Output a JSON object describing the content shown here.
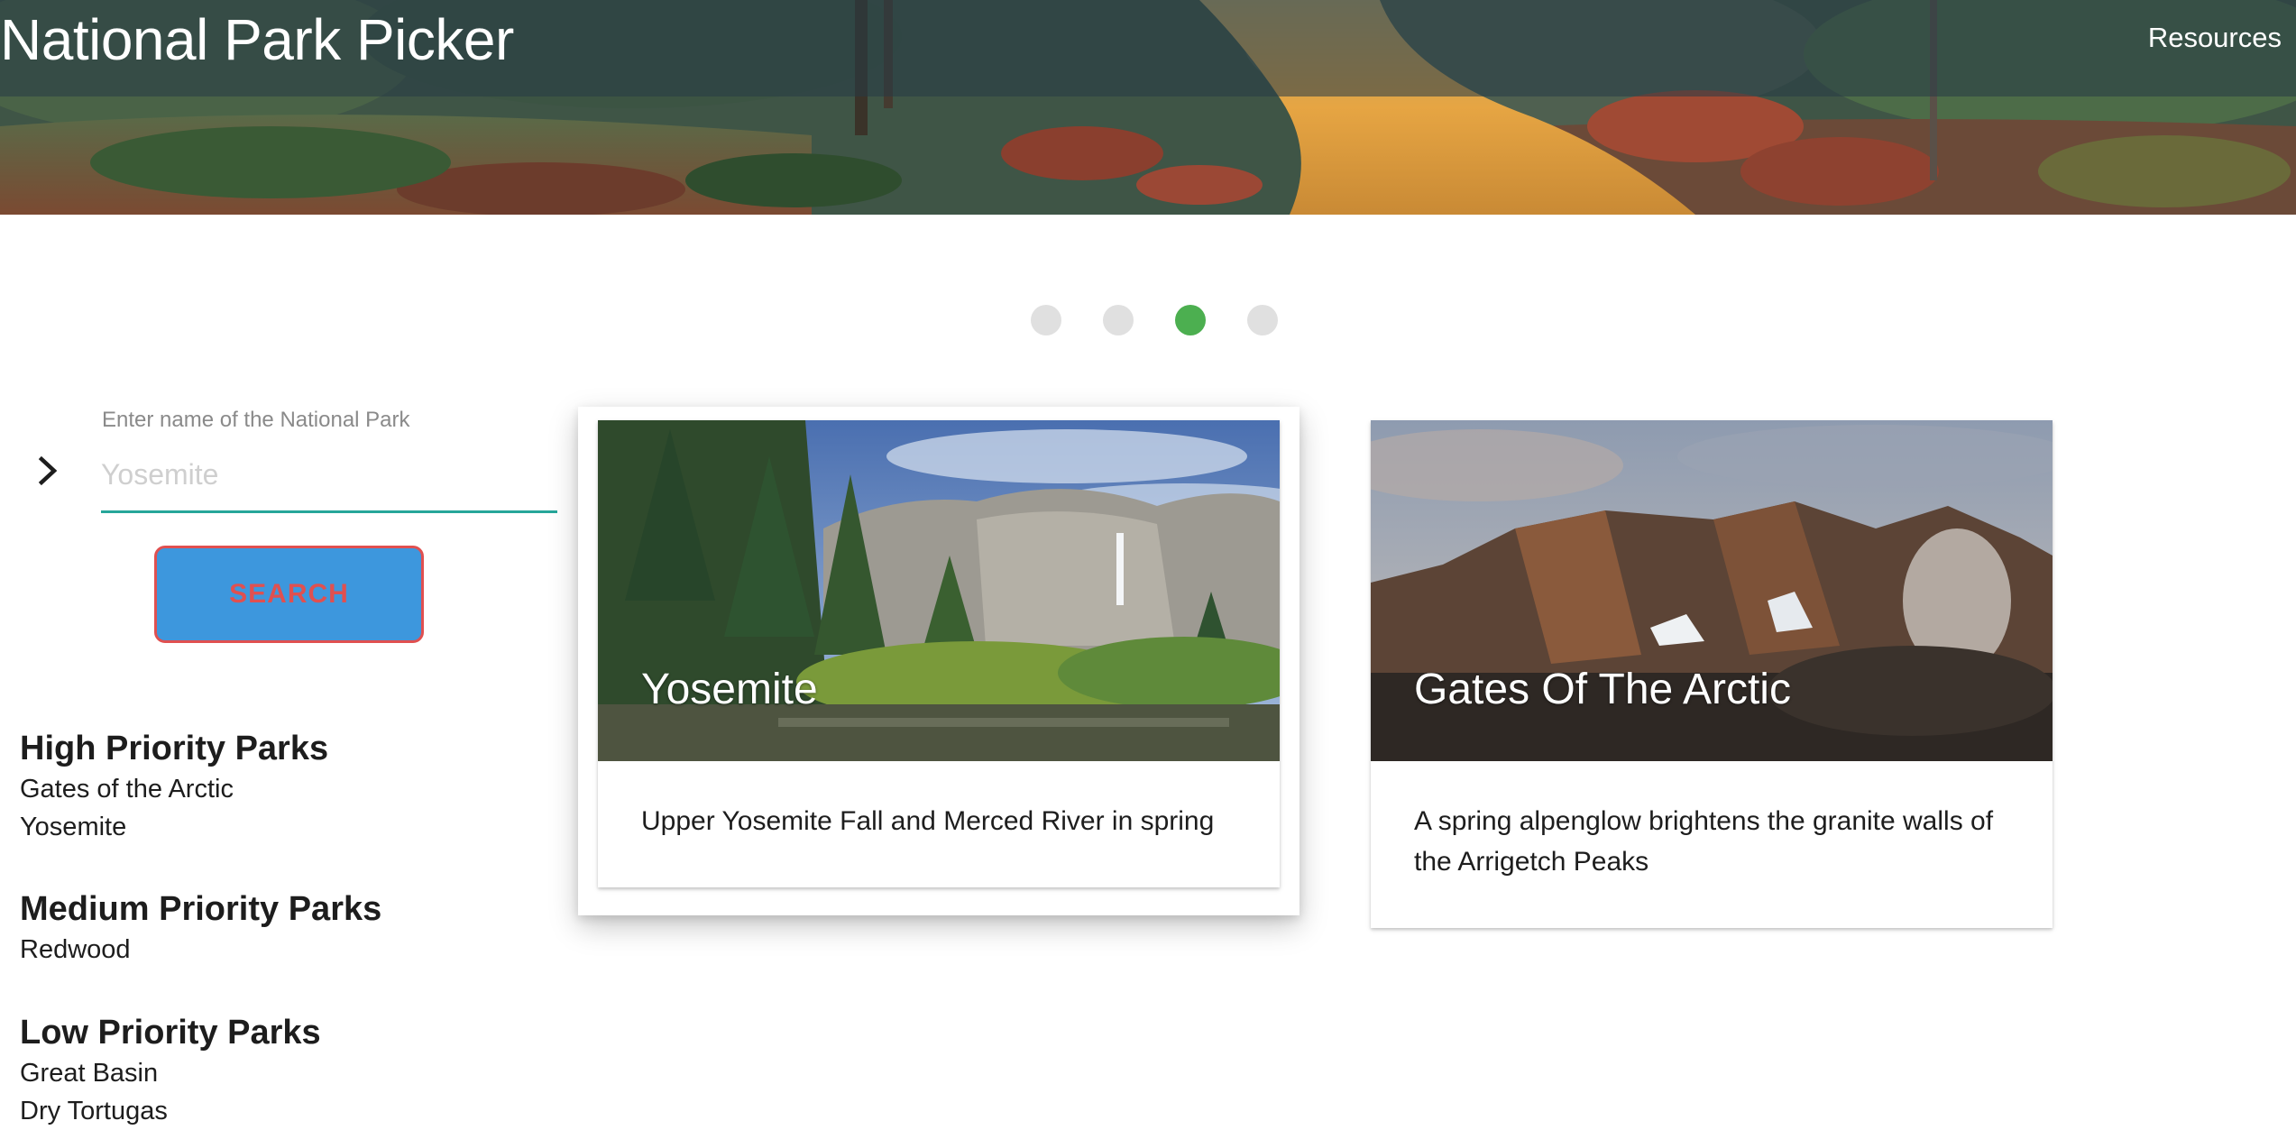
{
  "header": {
    "brand": "National Park Picker",
    "nav_resources": "Resources"
  },
  "carousel": {
    "indicator_count": 4,
    "active_index": 2,
    "active_color": "#4caf50",
    "inactive_color": "#e0e0e0"
  },
  "search": {
    "label": "Enter name of the National Park",
    "placeholder": "Yosemite",
    "value": "",
    "button_label": "SEARCH",
    "underline_color": "#26a69a"
  },
  "priorities": {
    "high": {
      "title": "High Priority Parks",
      "parks": [
        "Gates of the Arctic",
        "Yosemite"
      ]
    },
    "medium": {
      "title": "Medium Priority Parks",
      "parks": [
        "Redwood"
      ]
    },
    "low": {
      "title": "Low Priority Parks",
      "parks": [
        "Great Basin",
        "Dry Tortugas"
      ]
    }
  },
  "cards": [
    {
      "title": "Yosemite",
      "caption": "Upper Yosemite Fall and Merced River in spring"
    },
    {
      "title": "Gates Of The Arctic",
      "caption": "A spring alpenglow brightens the granite walls of the Arrigetch Peaks"
    }
  ]
}
